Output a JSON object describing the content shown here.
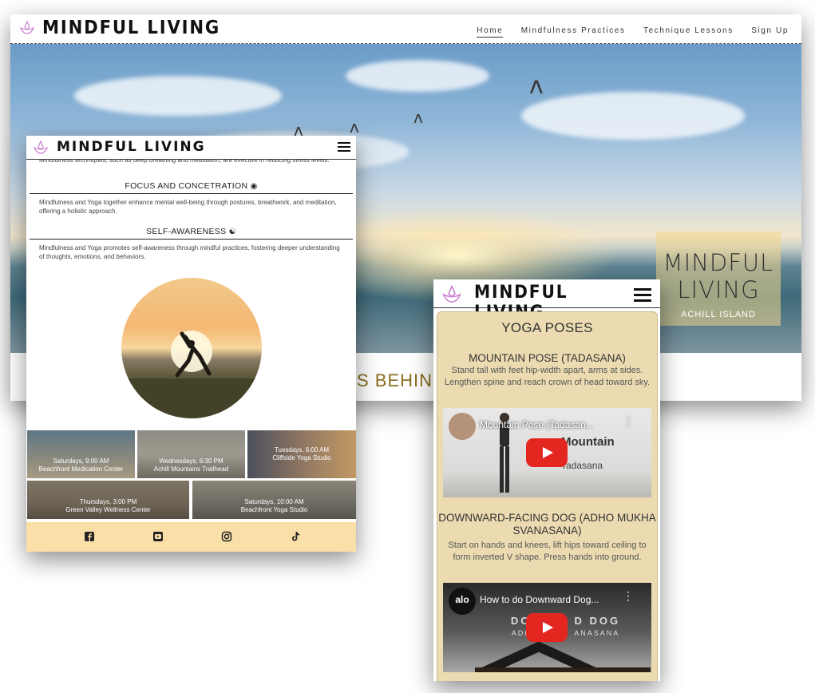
{
  "brand": "MINDFUL LIVING",
  "colors": {
    "accent_gold": "#8a6d1f",
    "footer_bg": "#fbdfa9",
    "panel_bg": "#ecdbb1",
    "youtube_red": "#e42621",
    "lotus": "#c97fd0"
  },
  "desktop": {
    "nav_links": [
      {
        "label": "Home",
        "active": true
      },
      {
        "label": "Mindfulness Practices",
        "active": false
      },
      {
        "label": "Technique Lessons",
        "active": false
      },
      {
        "label": "Sign Up",
        "active": false
      }
    ],
    "hero_title": "MINDFUL LIVING",
    "hero_subtitle": "ACHILL ISLAND",
    "section_heading": "ONS BEHIN"
  },
  "tablet": {
    "intro_text": "Mindfulness techniques, such as deep breathing and meditation, are effective in reducing stress levels.",
    "sections": [
      {
        "title": "FOCUS AND CONCETRATION",
        "icon": "eye-icon",
        "text": "Mindfulness and Yoga together enhance mental well-being through postures, breathwork, and meditation, offering a holistic approach."
      },
      {
        "title": "SELF-AWARENESS",
        "icon": "yin-yang-icon",
        "text": "Mindfulness and Yoga promotes self-awareness through mindful practices, fostering deeper understanding of thoughts, emotions, and behaviors."
      }
    ],
    "classes": [
      {
        "time": "Saturdays, 9:00 AM",
        "place": "Beachfront Medication Center"
      },
      {
        "time": "Wednesdays, 6:30 PM",
        "place": "Achill Mountains Trailhead"
      },
      {
        "time": "Tuesdays, 6:00 AM",
        "place": "Cliffside Yoga Studio"
      },
      {
        "time": "Thursdays, 3:00 PM",
        "place": "Green Valley Wellness Center"
      },
      {
        "time": "Saturdays, 10:00 AM",
        "place": "Beachfront Yoga Studio"
      }
    ],
    "social_icons": [
      "facebook-icon",
      "youtube-icon",
      "instagram-icon",
      "tiktok-icon"
    ]
  },
  "mobile": {
    "title": "YOGA POSES",
    "poses": [
      {
        "title": "MOUNTAIN POSE (TADASANA)",
        "desc": "Stand tall with feet hip-width apart, arms at sides. Lengthen spine and reach crown of head toward sky.",
        "video_title": "Mountain Pose (Tadasan...",
        "video_overlay": "Mountain",
        "video_overlay2": "Tadasana"
      },
      {
        "title": "DOWNWARD-FACING DOG (ADHO MUKHA SVANASANA)",
        "desc": "Start on hands and knees, lift hips toward ceiling to form inverted V shape. Press hands into ground.",
        "video_title": "How to do Downward Dog...",
        "video_overlay": "DOWN    D DOG",
        "video_overlay2": "ADHO MU     ANASANA",
        "channel_logo": "alo"
      }
    ]
  }
}
